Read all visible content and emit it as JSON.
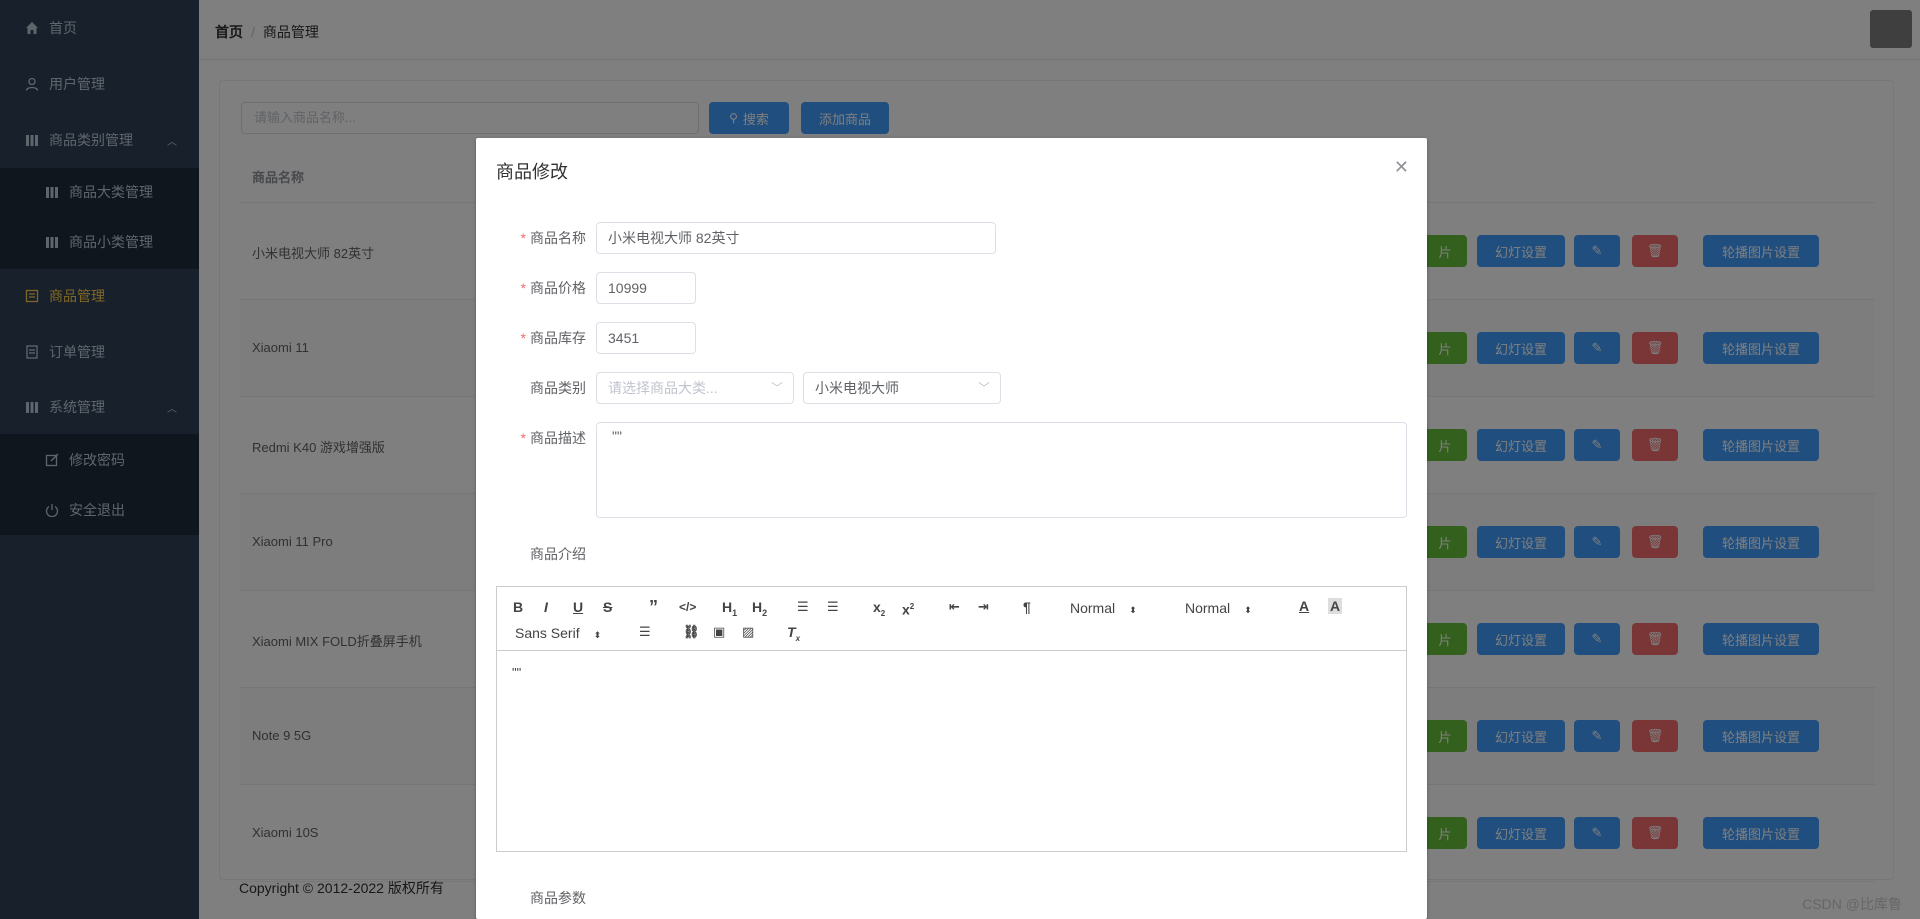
{
  "sidebar": {
    "items": [
      {
        "label": "首页",
        "icon": "home-icon"
      },
      {
        "label": "用户管理",
        "icon": "user-icon"
      },
      {
        "label": "商品类别管理",
        "icon": "category-icon"
      },
      {
        "label": "商品大类管理",
        "icon": "category-icon"
      },
      {
        "label": "商品小类管理",
        "icon": "category-icon"
      },
      {
        "label": "商品管理",
        "icon": "goods-icon"
      },
      {
        "label": "订单管理",
        "icon": "order-icon"
      },
      {
        "label": "系统管理",
        "icon": "system-icon"
      },
      {
        "label": "修改密码",
        "icon": "edit-icon"
      },
      {
        "label": "安全退出",
        "icon": "power-icon"
      }
    ],
    "colors": {
      "bg": "#304156",
      "text": "#bfcbd9",
      "active": "#ffd04b"
    }
  },
  "breadcrumb": {
    "home": "首页",
    "current": "商品管理"
  },
  "toolbar": {
    "search_placeholder": "请输入商品名称...",
    "search_label": "搜索",
    "add_label": "添加商品"
  },
  "table": {
    "header_name": "商品名称",
    "rows": [
      {
        "name": "小米电视大师 82英寸"
      },
      {
        "name": "Xiaomi 11"
      },
      {
        "name": "Redmi K40 游戏增强版"
      },
      {
        "name": "Xiaomi 11 Pro"
      },
      {
        "name": "Xiaomi MIX FOLD折叠屏手机"
      },
      {
        "name": "Note 9 5G"
      },
      {
        "name": "Xiaomi 10S"
      }
    ],
    "actions": {
      "image_partial": "片",
      "slide": "幻灯设置",
      "carousel": "轮播图片设置"
    }
  },
  "footer": {
    "copyright": "Copyright © 2012-2022 版权所有"
  },
  "watermark": "CSDN @比库鲁",
  "dialog": {
    "title": "商品修改",
    "fields": {
      "name_label": "商品名称",
      "name_value": "小米电视大师 82英寸",
      "price_label": "商品价格",
      "price_value": "10999",
      "stock_label": "商品库存",
      "stock_value": "3451",
      "category_label": "商品类别",
      "big_category_placeholder": "请选择商品大类...",
      "small_category_value": "小米电视大师",
      "desc_label": "商品描述",
      "desc_value": "\"\"",
      "intro_label": "商品介绍",
      "params_label": "商品参数"
    },
    "editor": {
      "header_select": "Normal",
      "size_select": "Normal",
      "font_select": "Sans Serif",
      "content": "\"\""
    }
  }
}
